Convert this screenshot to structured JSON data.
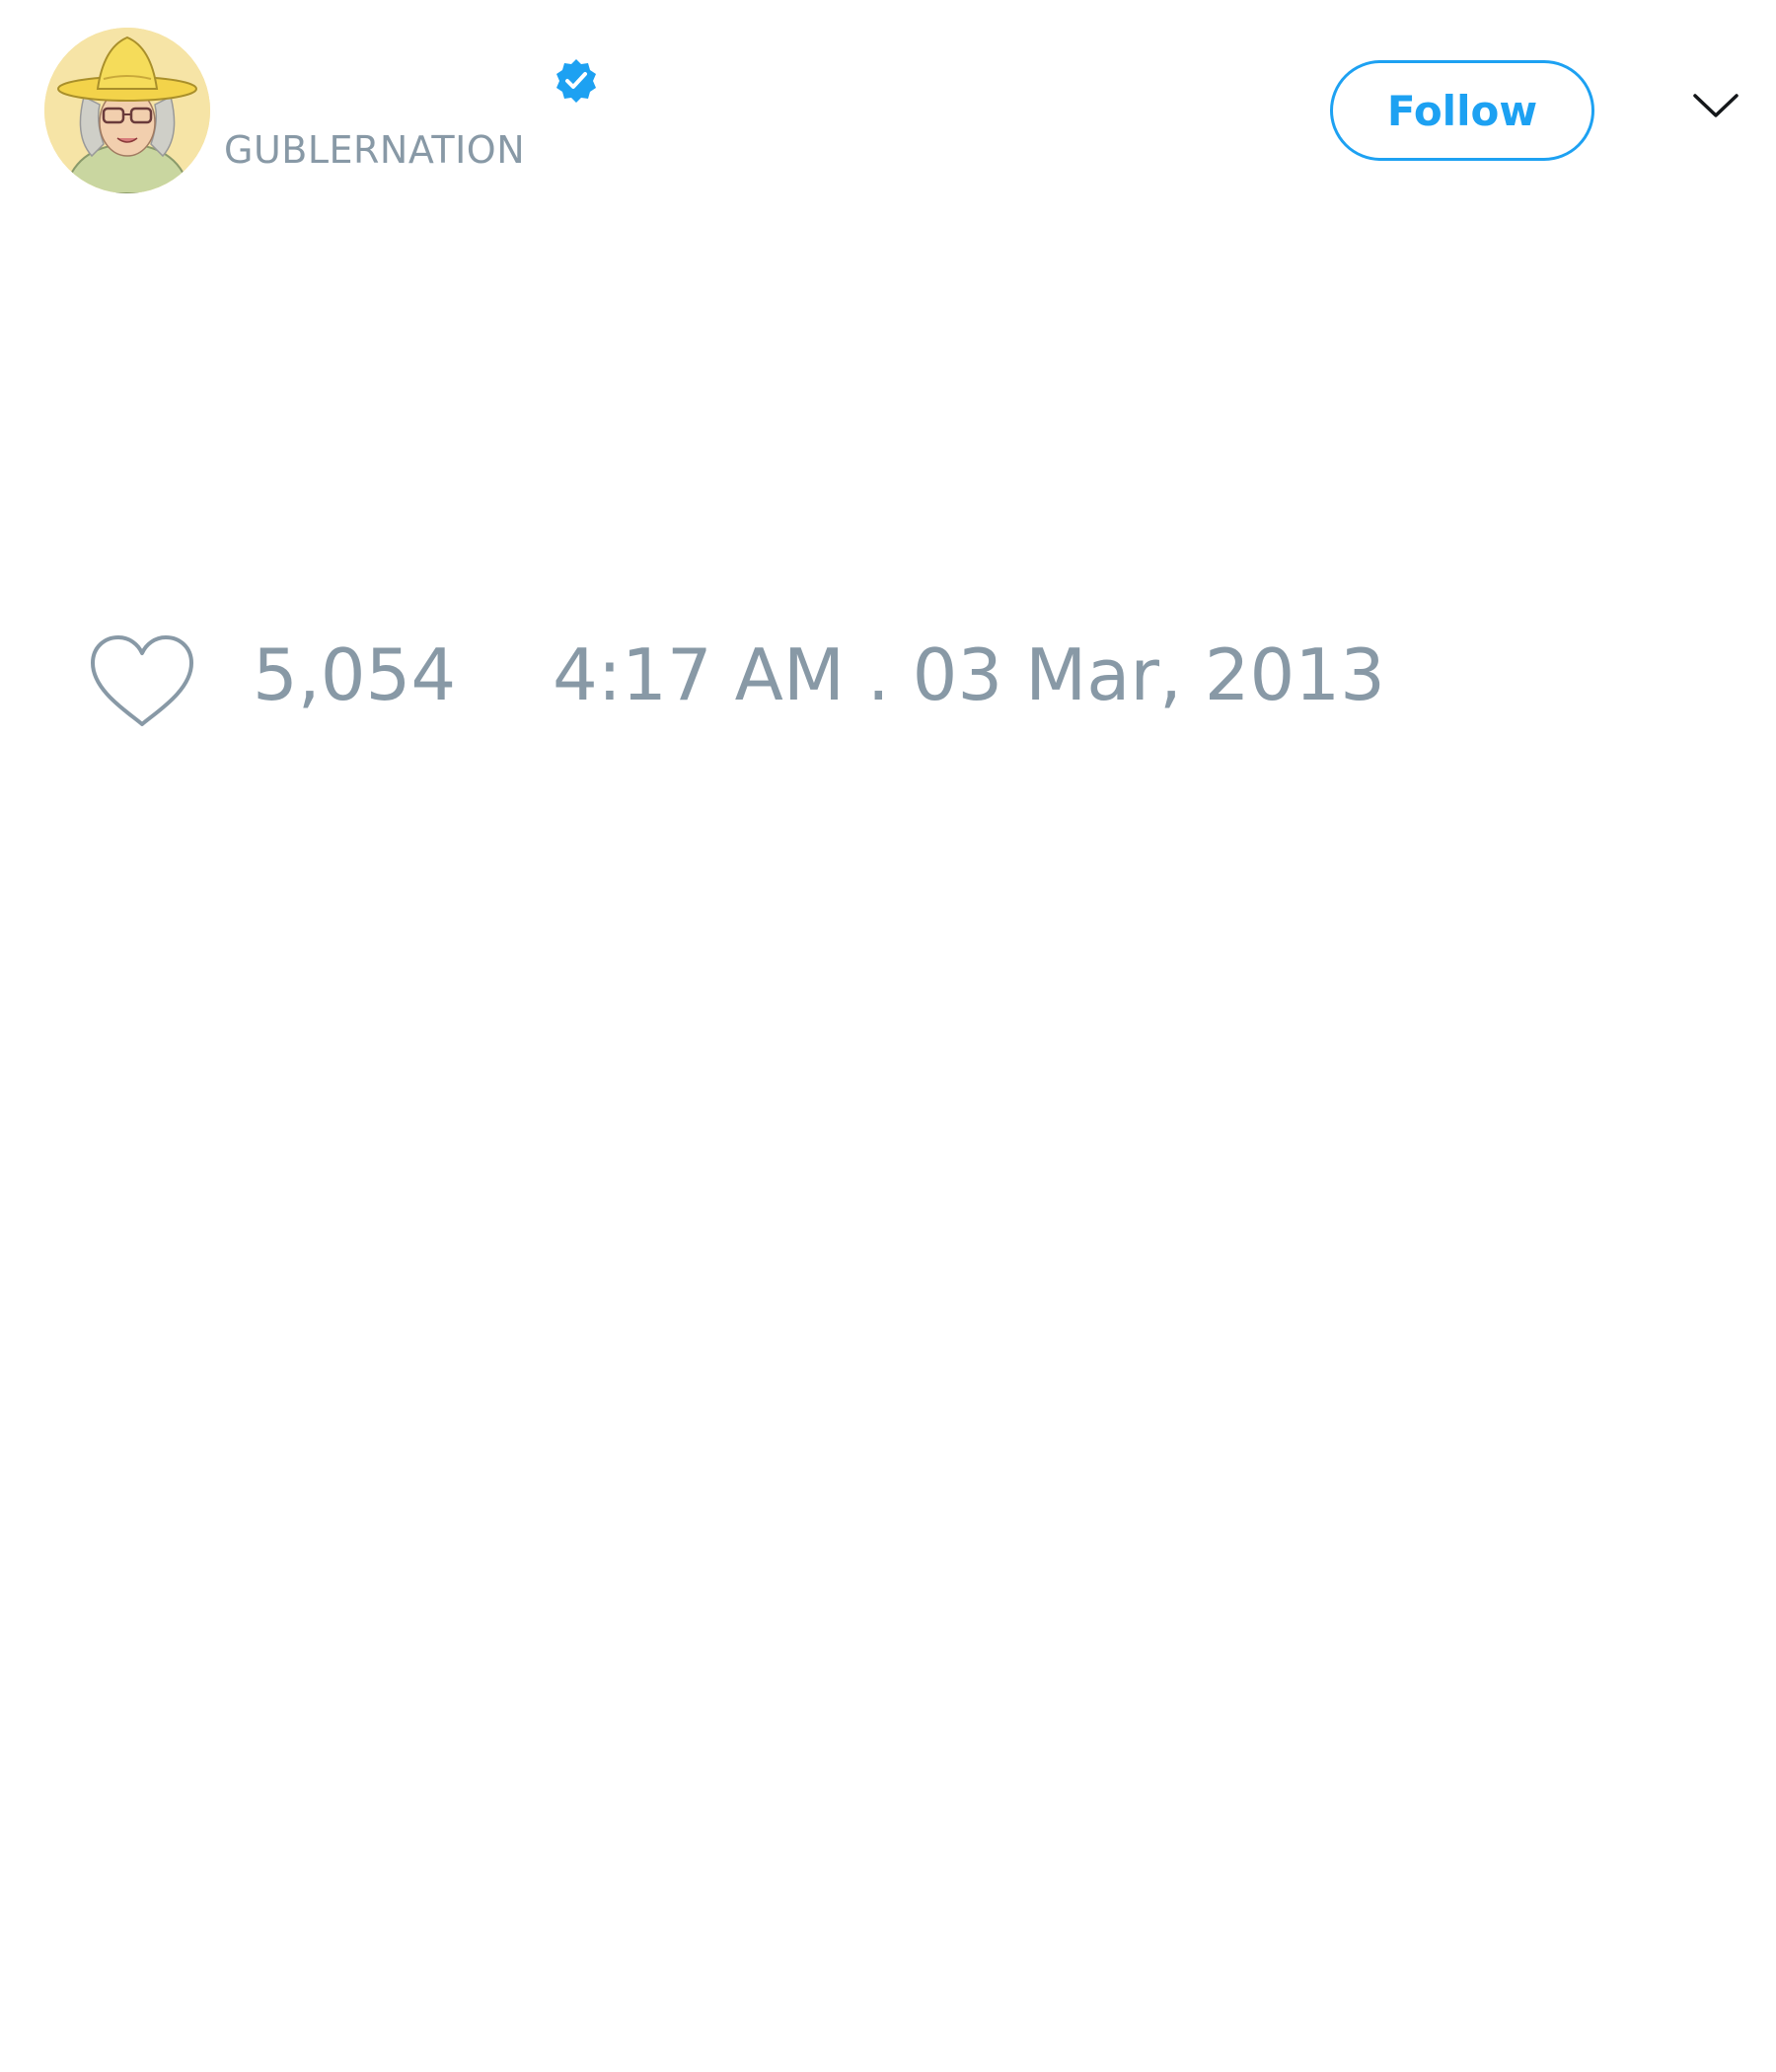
{
  "user": {
    "handle": "GUBLERNATION",
    "verified": true,
    "avatar_icon": "illustrated-person-straw-hat"
  },
  "header": {
    "follow_label": "Follow",
    "menu_icon": "chevron-down-icon"
  },
  "tweet": {
    "like_count": "5,054",
    "timestamp": "4:17 AM . 03 Mar, 2013"
  },
  "colors": {
    "accent": "#1da1f2",
    "muted_text": "#8899a6",
    "background": "#ffffff"
  }
}
